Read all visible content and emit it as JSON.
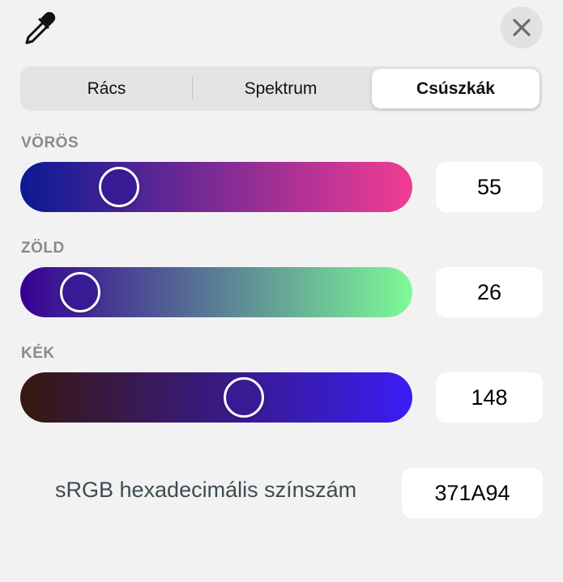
{
  "toolbar": {
    "eyedropper_icon": "eyedropper-icon",
    "close_icon": "close-icon"
  },
  "tabs": {
    "selected_index": 2,
    "items": [
      {
        "label": "Rács"
      },
      {
        "label": "Spektrum"
      },
      {
        "label": "Csúszkák"
      }
    ]
  },
  "sliders": {
    "red": {
      "label": "VÖRÖS",
      "value": "55",
      "max": 255,
      "gradient_start": "#0a1a94",
      "gradient_end": "#f23c94"
    },
    "green": {
      "label": "ZÖLD",
      "value": "26",
      "max": 255,
      "gradient_start": "#370094",
      "gradient_end": "#7dfa96"
    },
    "blue": {
      "label": "KÉK",
      "value": "148",
      "max": 255,
      "gradient_start": "#37180e",
      "gradient_end": "#3a1df5"
    }
  },
  "hex": {
    "label": "sRGB hexadecimális színszám",
    "value": "371A94"
  },
  "current_color": "#371A94"
}
